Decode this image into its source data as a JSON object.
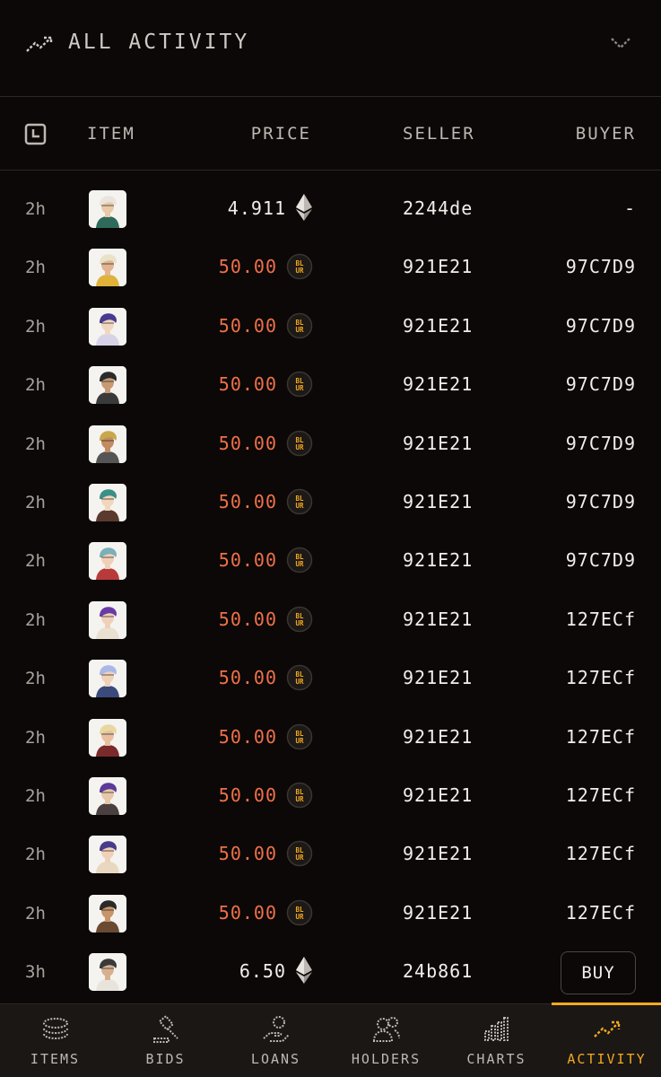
{
  "header": {
    "title": "ALL ACTIVITY",
    "icon": "trending-up-icon",
    "chevron": "chevron-down-icon"
  },
  "columns": {
    "item": "ITEM",
    "price": "PRICE",
    "seller": "SELLER",
    "buyer": "BUYER"
  },
  "colors": {
    "blur_price": "#f0704a",
    "accent": "#f4a91f",
    "background": "#0b0807"
  },
  "rows": [
    {
      "time": "2h",
      "price": "4.911",
      "currency": "eth",
      "seller": "2244de",
      "buyer": "-"
    },
    {
      "time": "2h",
      "price": "50.00",
      "currency": "blur",
      "seller": "921E21",
      "buyer": "97C7D9"
    },
    {
      "time": "2h",
      "price": "50.00",
      "currency": "blur",
      "seller": "921E21",
      "buyer": "97C7D9"
    },
    {
      "time": "2h",
      "price": "50.00",
      "currency": "blur",
      "seller": "921E21",
      "buyer": "97C7D9"
    },
    {
      "time": "2h",
      "price": "50.00",
      "currency": "blur",
      "seller": "921E21",
      "buyer": "97C7D9"
    },
    {
      "time": "2h",
      "price": "50.00",
      "currency": "blur",
      "seller": "921E21",
      "buyer": "97C7D9"
    },
    {
      "time": "2h",
      "price": "50.00",
      "currency": "blur",
      "seller": "921E21",
      "buyer": "97C7D9"
    },
    {
      "time": "2h",
      "price": "50.00",
      "currency": "blur",
      "seller": "921E21",
      "buyer": "127ECf"
    },
    {
      "time": "2h",
      "price": "50.00",
      "currency": "blur",
      "seller": "921E21",
      "buyer": "127ECf"
    },
    {
      "time": "2h",
      "price": "50.00",
      "currency": "blur",
      "seller": "921E21",
      "buyer": "127ECf"
    },
    {
      "time": "2h",
      "price": "50.00",
      "currency": "blur",
      "seller": "921E21",
      "buyer": "127ECf"
    },
    {
      "time": "2h",
      "price": "50.00",
      "currency": "blur",
      "seller": "921E21",
      "buyer": "127ECf"
    },
    {
      "time": "2h",
      "price": "50.00",
      "currency": "blur",
      "seller": "921E21",
      "buyer": "127ECf"
    },
    {
      "time": "3h",
      "price": "6.50",
      "currency": "eth",
      "seller": "24b861",
      "buyer": "",
      "buy_label": "BUY"
    }
  ],
  "avatars": [
    {
      "hair": "#e9e4de",
      "skin": "#e8c9a8",
      "shirt": "#2f6b5a"
    },
    {
      "hair": "#e9e2c8",
      "skin": "#e2b48f",
      "shirt": "#e0b23a"
    },
    {
      "hair": "#4a3a8f",
      "skin": "#f0d8c0",
      "shirt": "#d8d2e8"
    },
    {
      "hair": "#2b2b2b",
      "skin": "#c89a74",
      "shirt": "#3a3a3a"
    },
    {
      "hair": "#c8a84a",
      "skin": "#c48a62",
      "shirt": "#555555"
    },
    {
      "hair": "#3a8f86",
      "skin": "#f1d6bc",
      "shirt": "#5a3a2e"
    },
    {
      "hair": "#7ab0b8",
      "skin": "#f0d0b8",
      "shirt": "#b83a3a"
    },
    {
      "hair": "#6a3aa8",
      "skin": "#f0d0b8",
      "shirt": "#e8e0d0"
    },
    {
      "hair": "#a8b8e8",
      "skin": "#f0d0b8",
      "shirt": "#3a4a7a"
    },
    {
      "hair": "#e8d8a0",
      "skin": "#e8c0a0",
      "shirt": "#7a2a2a"
    },
    {
      "hair": "#5a3a9a",
      "skin": "#e8c8a8",
      "shirt": "#4a4040"
    },
    {
      "hair": "#4a3a8a",
      "skin": "#f0d0b8",
      "shirt": "#e8d8c0"
    },
    {
      "hair": "#2a2a2a",
      "skin": "#c8946a",
      "shirt": "#6a4a30"
    },
    {
      "hair": "#3a3a3a",
      "skin": "#d8b090",
      "shirt": "#e8e4dc"
    }
  ],
  "tabs": [
    {
      "label": "ITEMS",
      "icon": "layers-icon",
      "active": false
    },
    {
      "label": "BIDS",
      "icon": "gavel-icon",
      "active": false
    },
    {
      "label": "LOANS",
      "icon": "loan-hand-icon",
      "active": false
    },
    {
      "label": "HOLDERS",
      "icon": "users-icon",
      "active": false
    },
    {
      "label": "CHARTS",
      "icon": "bar-chart-icon",
      "active": false
    },
    {
      "label": "ACTIVITY",
      "icon": "trending-up-icon",
      "active": true
    }
  ]
}
